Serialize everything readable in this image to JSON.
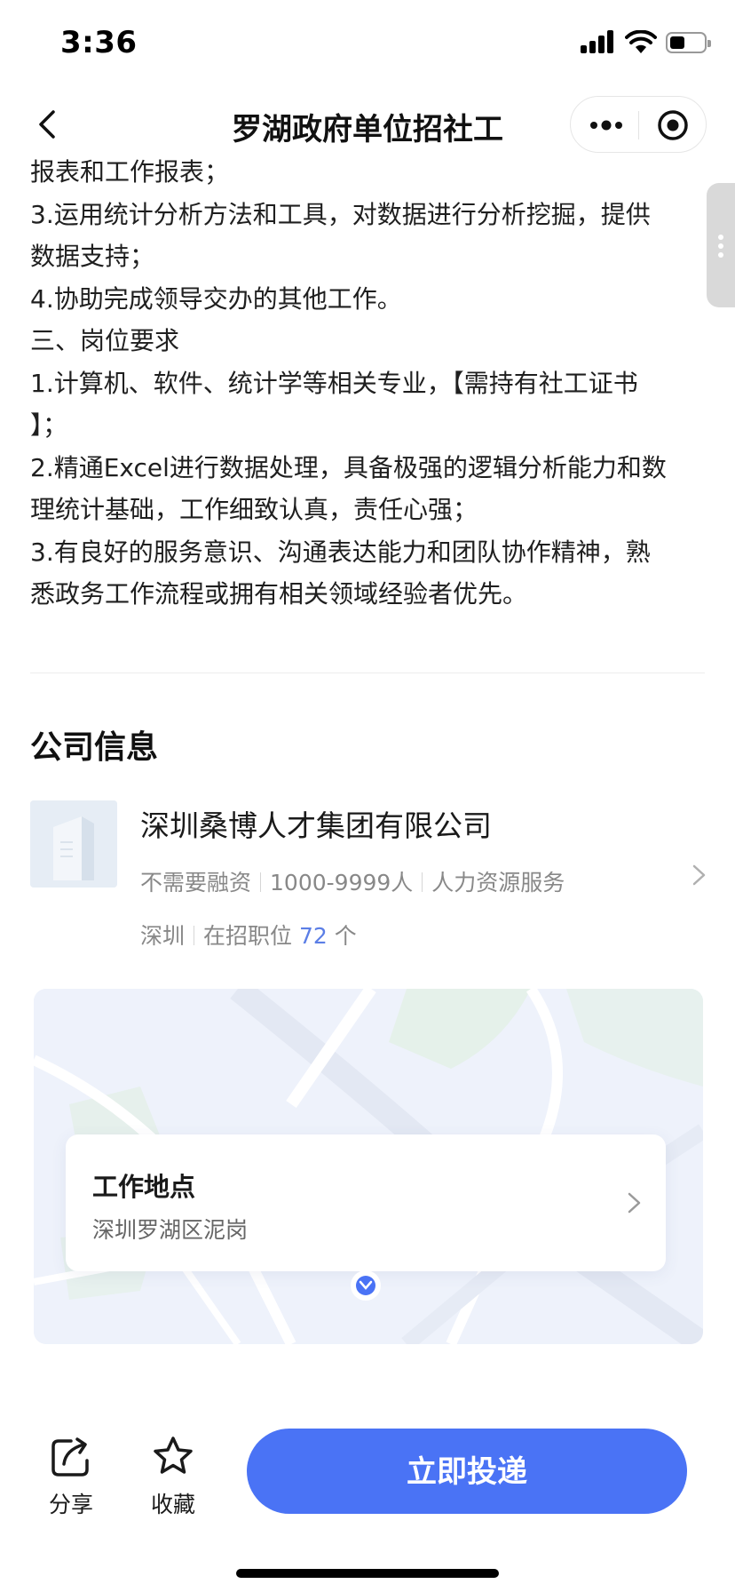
{
  "status_bar": {
    "time": "3:36"
  },
  "nav": {
    "title": "罗湖政府单位招社工"
  },
  "description": {
    "lines": [
      "报表和工作报表；",
      "3.运用统计分析方法和工具，对数据进行分析挖掘，提供",
      "数据支持；",
      "4.协助完成领导交办的其他工作。",
      "三、岗位要求",
      "1.计算机、软件、统计学等相关专业，【需持有社工证书",
      "】；",
      "2.精通Excel进行数据处理，具备极强的逻辑分析能力和数",
      "理统计基础，工作细致认真，责任心强；",
      "3.有良好的服务意识、沟通表达能力和团队协作精神，熟",
      "悉政务工作流程或拥有相关领域经验者优先。"
    ]
  },
  "company_section": {
    "title": "公司信息",
    "name": "深圳桑博人才集团有限公司",
    "financing": "不需要融资",
    "size": "1000-9999人",
    "industry": "人力资源服务",
    "city": "深圳",
    "jobs_prefix": "在招职位",
    "jobs_count": "72",
    "jobs_suffix": "个"
  },
  "location": {
    "title": "工作地点",
    "address": "深圳罗湖区泥岗"
  },
  "bottom_bar": {
    "share_label": "分享",
    "favorite_label": "收藏",
    "apply_label": "立即投递"
  },
  "colors": {
    "accent": "#4a73f5",
    "link_number": "#5b7ee6",
    "map_background": "#eef2fb"
  },
  "icons": {
    "back": "chevron-left-icon",
    "more": "more-dots-icon",
    "close": "target-circle-icon",
    "share": "share-icon",
    "favorite": "star-icon",
    "chevron": "chevron-right-icon",
    "pin": "map-pin-icon"
  }
}
